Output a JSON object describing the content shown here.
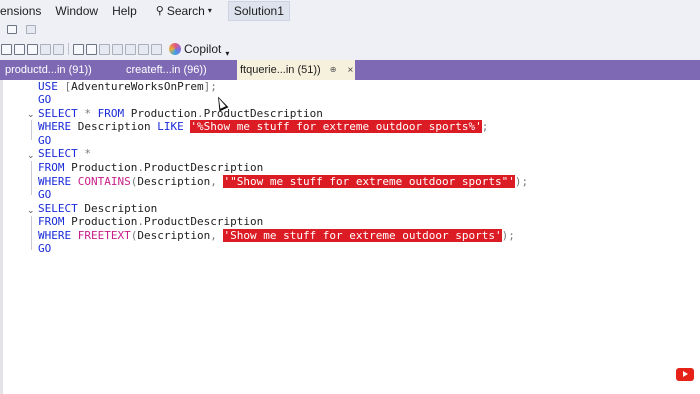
{
  "menu": {
    "items": [
      "ensions",
      "Window",
      "Help"
    ],
    "search_label": "Search",
    "solution": "Solution1"
  },
  "toolbar": {
    "copilot_label": "Copilot"
  },
  "tabs": [
    {
      "label": "productd...in (91))"
    },
    {
      "label": "createft...in (96))"
    },
    {
      "label": "ftquerie...in (51))",
      "active": true,
      "close": "×"
    }
  ],
  "editor": {
    "lines": [
      {
        "text": "USE [AdventureWorksOnPrem];"
      },
      {
        "text": "GO"
      },
      {
        "text": "SELECT * FROM Production.ProductDescription"
      },
      {
        "text": "WHERE Description LIKE '%Show me stuff for extreme outdoor sports%';"
      },
      {
        "text": "GO"
      },
      {
        "text": "SELECT *"
      },
      {
        "text": "FROM Production.ProductDescription"
      },
      {
        "text": "WHERE CONTAINS(Description, '\"Show me stuff for extreme outdoor sports\"');"
      },
      {
        "text": "GO"
      },
      {
        "text": "SELECT Description"
      },
      {
        "text": "FROM Production.ProductDescription"
      },
      {
        "text": "WHERE FREETEXT(Description, 'Show me stuff for extreme outdoor sports');"
      },
      {
        "text": "GO"
      }
    ]
  },
  "colors": {
    "keyword": "#1a2bd9",
    "function": "#c81e88",
    "highlight": "#dc1c24",
    "tab_bar": "#7e6ab4",
    "active_tab": "#f6f1dc"
  }
}
